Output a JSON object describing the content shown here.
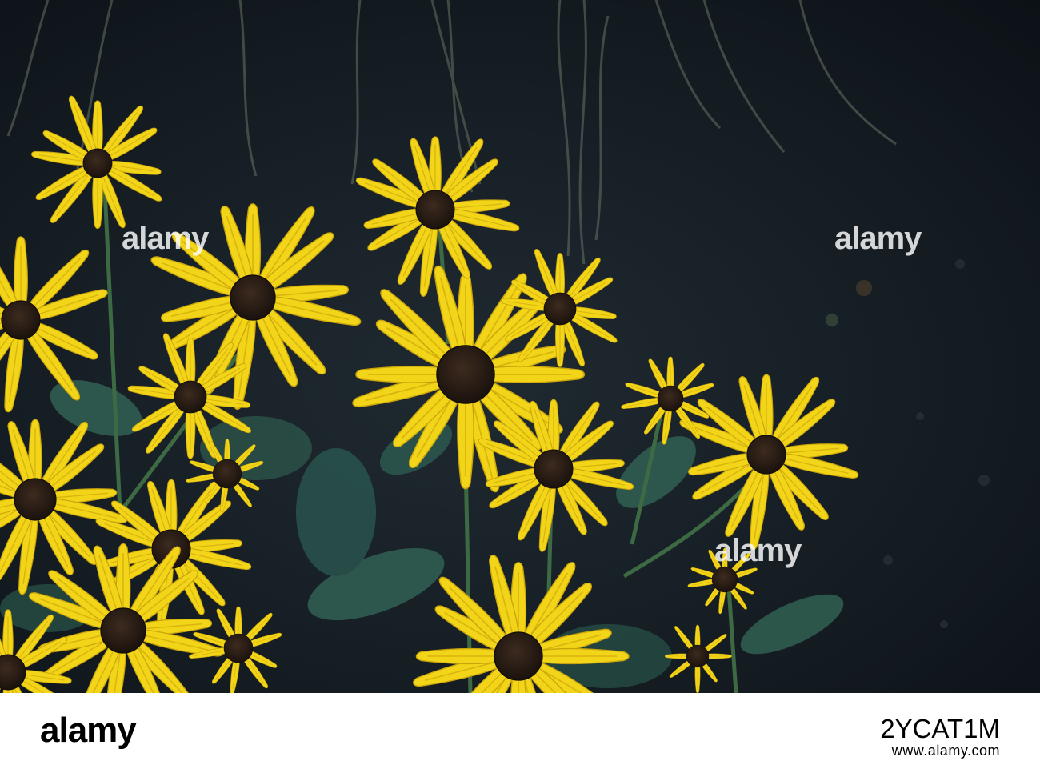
{
  "photo": {
    "subject": "black-eyed-susan flowers",
    "colors": {
      "petal": "#f2d418",
      "petal_shade": "#d9b40e",
      "center": "#2a1d14",
      "leaf": "#2f5a4f",
      "background": "#141c22"
    }
  },
  "watermarks": [
    "alamy",
    "alamy",
    "alamy"
  ],
  "footer": {
    "brand": "alamy",
    "image_code": "2YCAT1M",
    "url": "www.alamy.com"
  }
}
